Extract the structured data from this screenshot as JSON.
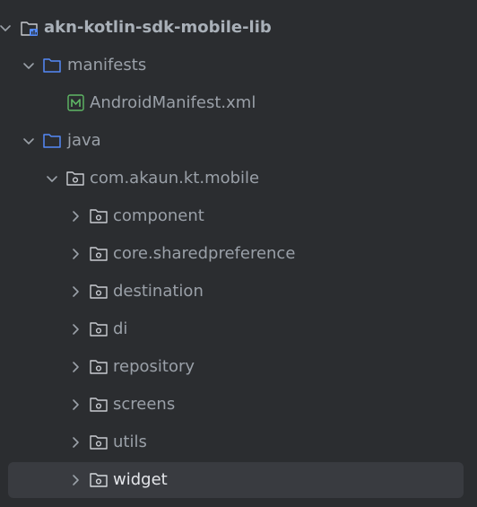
{
  "root": {
    "label": "akn-kotlin-sdk-mobile-lib",
    "icon": "module-folder-icon"
  },
  "manifests": {
    "label": "manifests",
    "icon": "folder-icon"
  },
  "manifest_file": {
    "label": "AndroidManifest.xml",
    "icon": "manifest-file-icon"
  },
  "java": {
    "label": "java",
    "icon": "folder-icon"
  },
  "package": {
    "label": "com.akaun.kt.mobile",
    "icon": "package-icon"
  },
  "subpackages": [
    {
      "label": "component"
    },
    {
      "label": "core.sharedpreference"
    },
    {
      "label": "destination"
    },
    {
      "label": "di"
    },
    {
      "label": "repository"
    },
    {
      "label": "screens"
    },
    {
      "label": "utils"
    },
    {
      "label": "widget",
      "selected": true
    }
  ],
  "colors": {
    "background": "#2b2d30",
    "selection": "#393b40",
    "folder_blue": "#548af7",
    "manifest_green": "#5fb865",
    "text": "#9aa0a8"
  }
}
